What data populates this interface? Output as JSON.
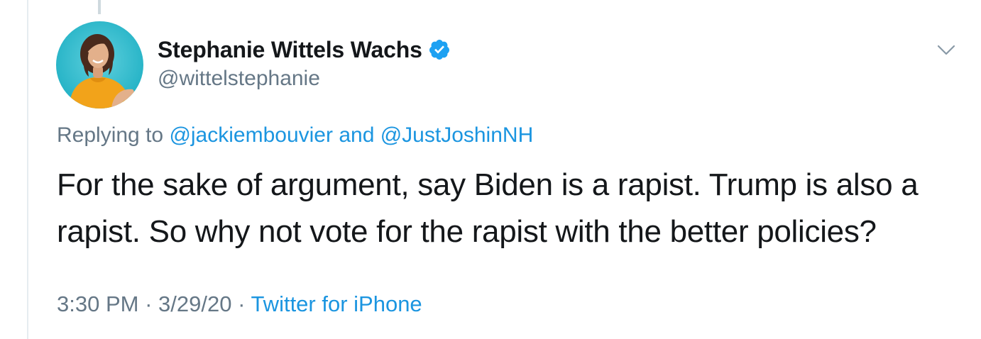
{
  "author": {
    "display_name": "Stephanie Wittels Wachs",
    "handle": "@wittelstephanie",
    "verified_icon": "verified-badge-icon"
  },
  "reply": {
    "prefix": "Replying to ",
    "mention_1": "@jackiembouvier",
    "conjunction": " and ",
    "mention_2": "@JustJoshinNH"
  },
  "tweet": {
    "text": "For the sake of argument, say Biden is a rapist. Trump is also a rapist. So why not vote for the rapist with the better policies?"
  },
  "meta": {
    "time": "3:30 PM",
    "separator_1": " · ",
    "date": "3/29/20",
    "separator_2": " · ",
    "source": "Twitter for iPhone"
  },
  "colors": {
    "link": "#1b95e0",
    "secondary_text": "#657786",
    "primary_text": "#14171a",
    "verified": "#1da1f2"
  }
}
